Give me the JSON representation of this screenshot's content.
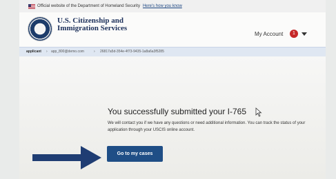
{
  "banner": {
    "text": "Official website of the Department of Homeland Security",
    "link": "Here's how you know"
  },
  "header": {
    "agency_name": "U.S. Citizenship and Immigration Services",
    "my_account_label": "My Account",
    "notification_count": "1"
  },
  "breadcrumb": {
    "items": [
      "applicant",
      "app_800@demo.com",
      "26817a5d-354e-4f73-9435-1a8a6a3f5285"
    ]
  },
  "main": {
    "title": "You successfully submitted your I-765",
    "message": "We will contact you if we have any questions or need additional information. You can track the status of your application through your USCIS online account.",
    "button_label": "Go to my cases"
  },
  "colors": {
    "primary": "#1f4e86",
    "arrow": "#1f3d73",
    "badge": "#c62828",
    "breadcrumb_bg": "#dfe7f2"
  },
  "icons": [
    "us-flag-icon",
    "dhs-seal-icon",
    "caret-down-icon",
    "mouse-cursor-icon",
    "arrow-right-icon"
  ]
}
